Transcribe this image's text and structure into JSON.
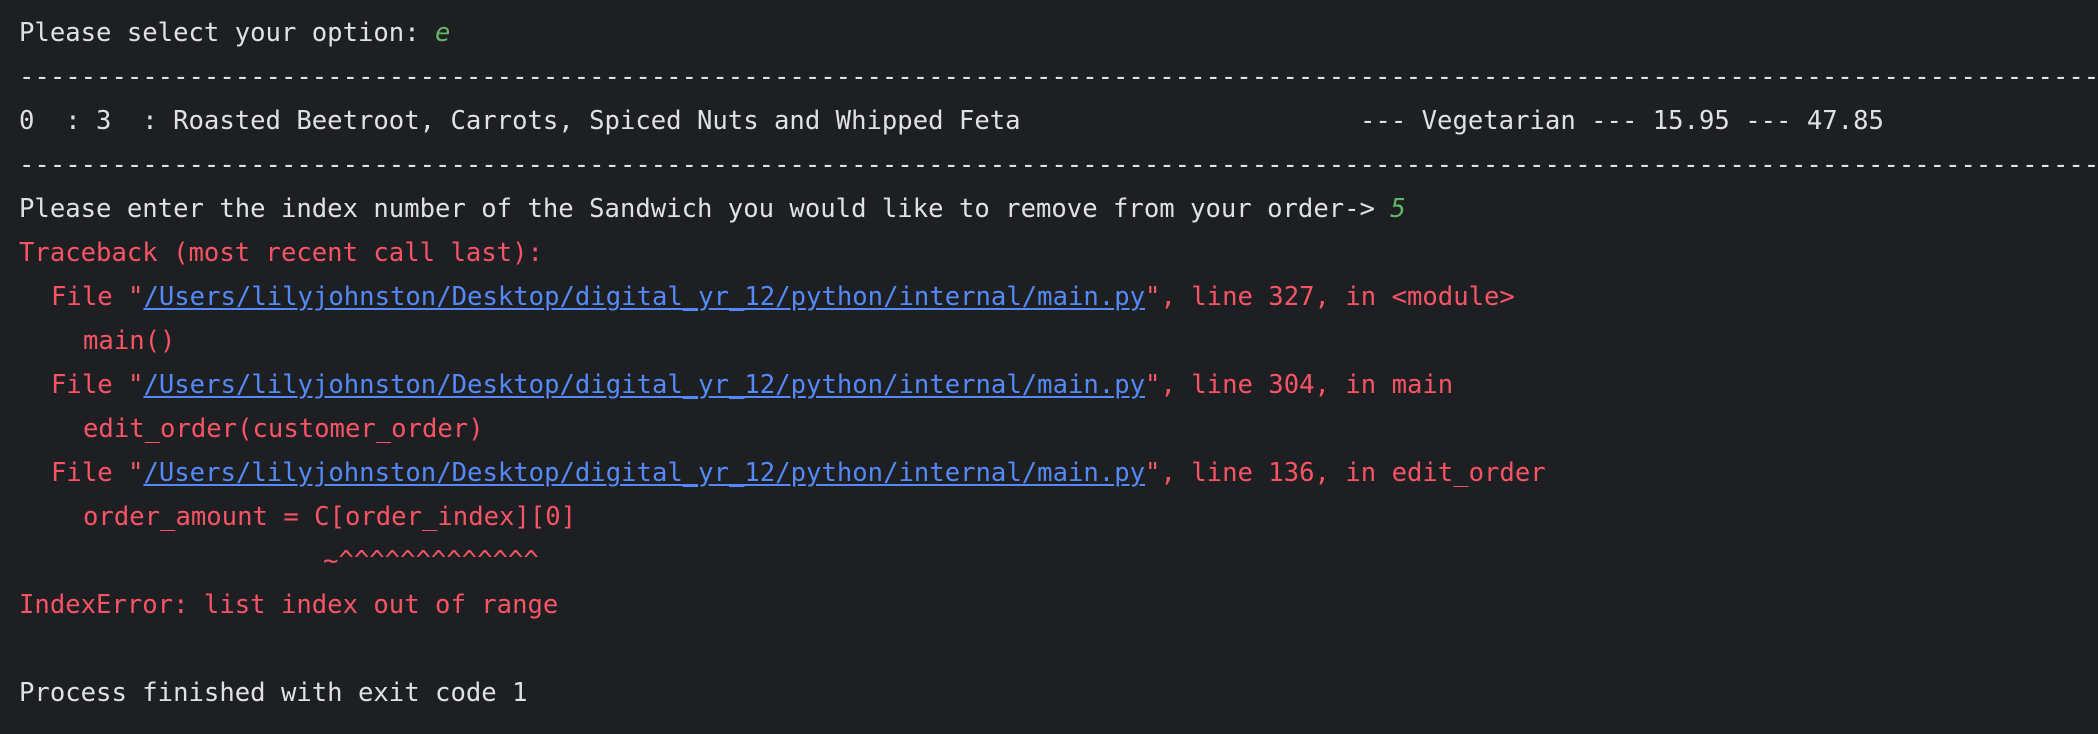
{
  "prompt_select": "Please select your option: ",
  "prompt_select_value": "e",
  "separator": "--------------------------------------------------------------------------------------------------------------------------------------------",
  "order_row": {
    "prefix": "0  : 3  : Roasted Beetroot, Carrots, Spiced Nuts and Whipped Feta",
    "suffix": "--- Vegetarian --- 15.95 --- 47.85"
  },
  "prompt_remove": "Please enter the index number of the Sandwich you would like to remove from your order-> ",
  "prompt_remove_value": "5",
  "traceback": {
    "header": "Traceback (most recent call last):",
    "frames": [
      {
        "file_prefix": "File \"",
        "path": "/Users/lilyjohnston/Desktop/digital_yr_12/python/internal/main.py",
        "file_suffix": "\", line 327, in <module>",
        "code": "main()"
      },
      {
        "file_prefix": "File \"",
        "path": "/Users/lilyjohnston/Desktop/digital_yr_12/python/internal/main.py",
        "file_suffix": "\", line 304, in main",
        "code": "edit_order(customer_order)"
      },
      {
        "file_prefix": "File \"",
        "path": "/Users/lilyjohnston/Desktop/digital_yr_12/python/internal/main.py",
        "file_suffix": "\", line 136, in edit_order",
        "code": "order_amount = C[order_index][0]",
        "caret": "~^^^^^^^^^^^^^"
      }
    ],
    "error": "IndexError: list index out of range"
  },
  "exit_message": "Process finished with exit code 1",
  "colors": {
    "background": "#1e1f22",
    "text": "#dfe1e5",
    "error": "#f75464",
    "link": "#548af7",
    "input": "#5fb865"
  }
}
